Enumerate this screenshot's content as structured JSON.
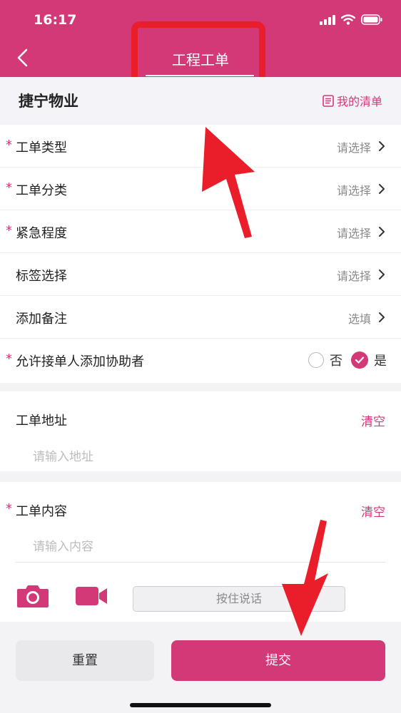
{
  "status_bar": {
    "time": "16:17"
  },
  "nav": {
    "title": "工程工单"
  },
  "company": {
    "name": "捷宁物业",
    "my_list_label": "我的清单"
  },
  "form": {
    "rows": [
      {
        "label": "工单类型",
        "required": true,
        "value": "请选择"
      },
      {
        "label": "工单分类",
        "required": true,
        "value": "请选择"
      },
      {
        "label": "紧急程度",
        "required": true,
        "value": "请选择"
      },
      {
        "label": "标签选择",
        "required": false,
        "value": "请选择"
      },
      {
        "label": "添加备注",
        "required": false,
        "value": "选填"
      }
    ],
    "assist": {
      "label": "允许接单人添加协助者",
      "required": true,
      "option_no": "否",
      "option_yes": "是",
      "selected": "是"
    }
  },
  "address": {
    "label": "工单地址",
    "clear": "清空",
    "placeholder": "请输入地址"
  },
  "content": {
    "label": "工单内容",
    "clear": "清空",
    "placeholder": "请输入内容"
  },
  "media": {
    "voice_label": "按住说话"
  },
  "actions": {
    "reset": "重置",
    "submit": "提交"
  },
  "required_mark": "*",
  "colors": {
    "brand": "#d33977",
    "annotation": "#ea1d2a"
  },
  "icons": [
    "back-icon",
    "signal-icon",
    "wifi-icon",
    "battery-icon",
    "list-icon",
    "chevron-right-icon",
    "check-icon",
    "camera-icon",
    "video-camera-icon"
  ]
}
